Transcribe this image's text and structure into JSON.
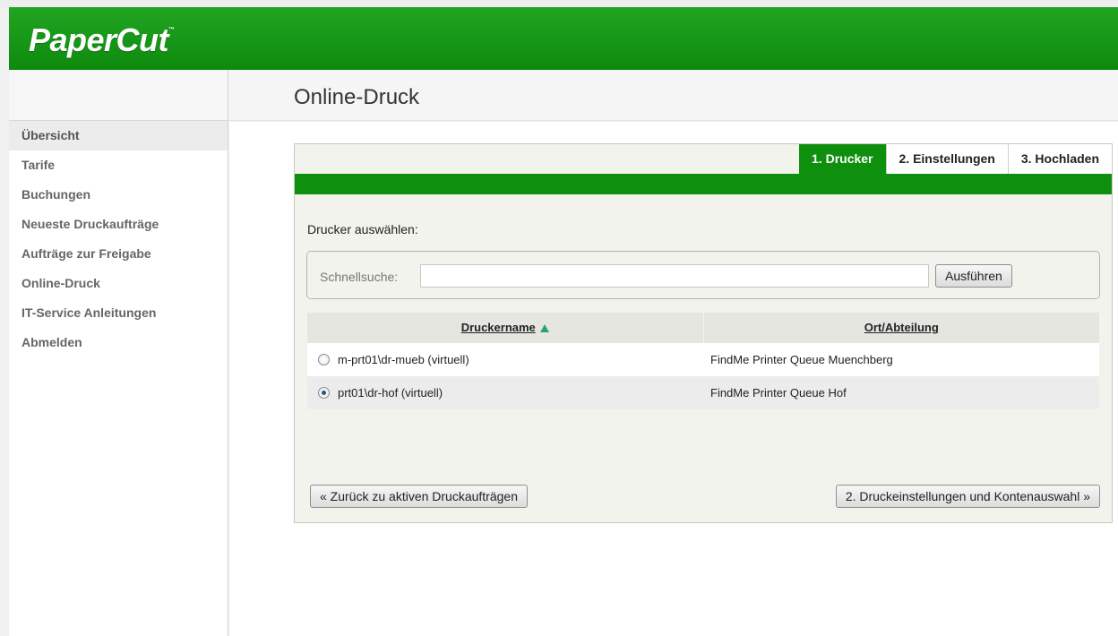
{
  "app": {
    "logo": "PaperCut",
    "logo_tm": "™"
  },
  "sidebar": {
    "items": [
      {
        "label": "Übersicht"
      },
      {
        "label": "Tarife"
      },
      {
        "label": "Buchungen"
      },
      {
        "label": "Neueste Druckaufträge"
      },
      {
        "label": "Aufträge zur Freigabe"
      },
      {
        "label": "Online-Druck"
      },
      {
        "label": "IT-Service Anleitungen"
      },
      {
        "label": "Abmelden"
      }
    ]
  },
  "page": {
    "title": "Online-Druck"
  },
  "wizard": {
    "tabs": [
      {
        "label": "1. Drucker",
        "active": true
      },
      {
        "label": "2. Einstellungen",
        "active": false
      },
      {
        "label": "3. Hochladen",
        "active": false
      }
    ],
    "select_label": "Drucker auswählen:",
    "search": {
      "label": "Schnellsuche:",
      "value": "",
      "button": "Ausführen"
    },
    "table": {
      "columns": [
        "Druckername",
        "Ort/Abteilung"
      ],
      "rows": [
        {
          "name": "m-prt01\\dr-mueb (virtuell)",
          "location": "FindMe Printer Queue Muenchberg",
          "selected": false
        },
        {
          "name": "prt01\\dr-hof (virtuell)",
          "location": "FindMe Printer Queue Hof",
          "selected": true
        }
      ]
    },
    "back_button": "« Zurück zu aktiven Druckaufträgen",
    "next_button": "2. Druckeinstellungen und Kontenauswahl »"
  },
  "colors": {
    "brand_green": "#0e8f0e",
    "sort_arrow": "#2aa36b"
  }
}
